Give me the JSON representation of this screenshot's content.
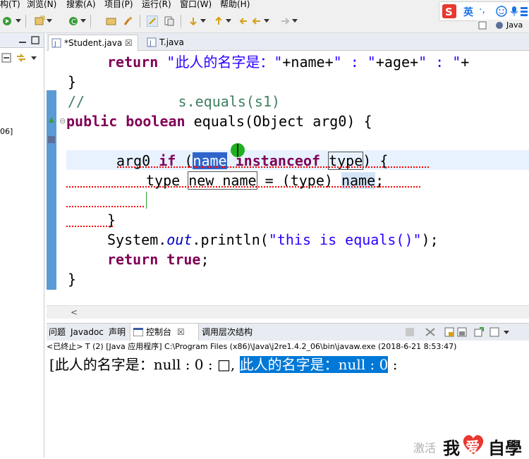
{
  "menu": [
    "构(T)",
    "浏览(N)",
    "搜索(A)",
    "项目(P)",
    "运行(R)",
    "窗口(W)",
    "帮助(H)"
  ],
  "ime": {
    "label": "英",
    "extra": "·,"
  },
  "perspective": "Java",
  "left_panel": {
    "label": "06]"
  },
  "editor": {
    "tabs": [
      {
        "label": "*Student.java",
        "close": "☒"
      },
      {
        "label": "T.java"
      }
    ],
    "lines": {
      "l1_kw": "return",
      "l1_s1": "\"此人的名字是：\"",
      "l1_m1": "+name+",
      "l1_s2": "\" : \"",
      "l1_m2": "+age+",
      "l1_s3": "\" : \"",
      "l1_m3": "+",
      "l2": "}",
      "l3": "//           s.equals(s1)",
      "l4_kw": "public boolean",
      "l4_rest": " equals(Object arg0) {",
      "l5_a": "arg0 ",
      "l5_if": "if",
      "l5_b": " (",
      "l5_name": "name",
      "l5_sp": " ",
      "l5_inst": "instanceof",
      "l5_sp2": " ",
      "l5_type": "type",
      "l5_end": ") {",
      "l6_a": "type ",
      "l6_new": "new name",
      "l6_b": " = (type) ",
      "l6_name": "name",
      "l6_c": ";",
      "l7": "}",
      "l8_a": "System.",
      "l8_out": "out",
      "l8_b": ".println(",
      "l8_str": "\"this is equals()\"",
      "l8_c": ");",
      "l9_kw": "return true",
      "l9_end": ";",
      "l10": "}"
    },
    "scroll_arrow": "<"
  },
  "console": {
    "tabs": [
      "问题",
      "Javadoc",
      "声明",
      "控制台",
      "调用层次结构"
    ],
    "console_close": "☒",
    "status": "<已终止> T (2) [Java 应用程序] C:\\Program Files (x86)\\Java\\j2re1.4.2_06\\bin\\javaw.exe  (2018-6-21 8:53:47)",
    "output_plain": "[此人的名字是：null : 0 : □, ",
    "output_selected": "此人的名字是：null : 0",
    "output_tail": " :"
  },
  "watermark": {
    "dim": "激活",
    "brand_a": "我",
    "brand_b": "爱",
    "brand_c": "自學"
  },
  "colors": {
    "keyword": "#7f0055",
    "string": "#2a00ff",
    "comment": "#3f7f5f",
    "selection": "#0078d7",
    "gutter": "#5b9bd5"
  }
}
